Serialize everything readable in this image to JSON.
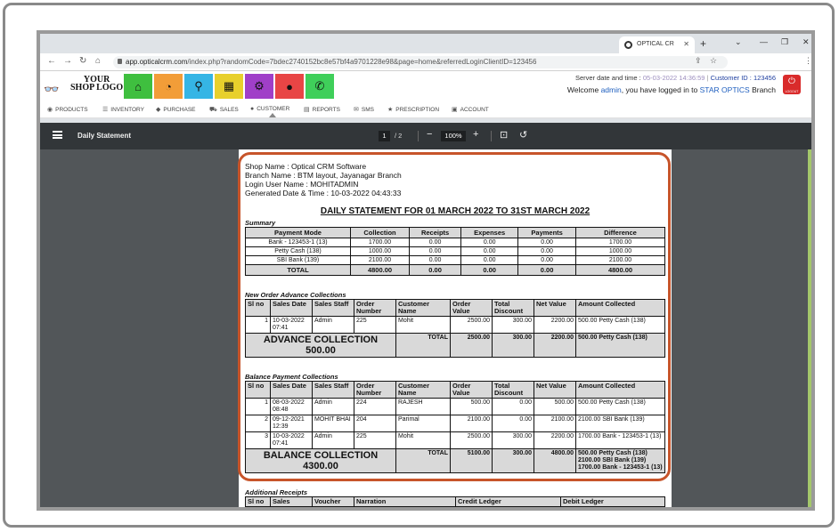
{
  "browser": {
    "tab_title": "OPTICAL CR",
    "url_host": "app.opticalcrm.com",
    "url_path": "/index.php?randomCode=7bdec2740152bc8e57bf4a9701228e98&page=home&referredLoginClientID=123456"
  },
  "header": {
    "logo_line1": "YOUR",
    "logo_line2": "SHOP LOGO",
    "server_label": "Server date and time :",
    "server_datetime": "05-03-2022 14:36:59",
    "customer_id": "Customer ID : 123456",
    "welcome_pre": "Welcome",
    "user": "admin",
    "welcome_mid": ", you have logged in to",
    "branch": "STAR OPTICS",
    "welcome_post": "Branch",
    "logout_label": "LOGOUT",
    "tiles": [
      {
        "icon": "home-icon",
        "color": "#3fbf3f"
      },
      {
        "icon": "dashboard-icon",
        "color": "#f29d38"
      },
      {
        "icon": "search-icon",
        "color": "#35b5e5"
      },
      {
        "icon": "grid-icon",
        "color": "#e8d02c"
      },
      {
        "icon": "gear-icon",
        "color": "#a03fc8"
      },
      {
        "icon": "user-icon",
        "color": "#e84545"
      },
      {
        "icon": "whatsapp-icon",
        "color": "#3fcf5a"
      }
    ]
  },
  "menu": [
    "PRODUCTS",
    "INVENTORY",
    "PURCHASE",
    "SALES",
    "CUSTOMER",
    "REPORTS",
    "SMS",
    "PRESCRIPTION",
    "ACCOUNT"
  ],
  "viewer": {
    "title": "Daily Statement",
    "page_current": "1",
    "page_total": "/ 2",
    "zoom": "100%"
  },
  "doc": {
    "shop": "Shop Name : Optical CRM Software",
    "branch": "Branch Name : BTM layout, Jayanagar Branch",
    "login_user": "Login User Name : MOHITADMIN",
    "generated": "Generated Date & Time  : 10-03-2022 04:43:33",
    "title": "DAILY STATEMENT FOR 01 MARCH 2022 TO 31ST MARCH 2022",
    "summary": {
      "heading": "Summary",
      "cols": [
        "Payment Mode",
        "Collection",
        "Receipts",
        "Expenses",
        "Payments",
        "Difference"
      ],
      "rows": [
        [
          "Bank - 123453-1 (13)",
          "1700.00",
          "0.00",
          "0.00",
          "0.00",
          "1700.00"
        ],
        [
          "Petty Cash (138)",
          "1000.00",
          "0.00",
          "0.00",
          "0.00",
          "1000.00"
        ],
        [
          "SBI Bank (139)",
          "2100.00",
          "0.00",
          "0.00",
          "0.00",
          "2100.00"
        ]
      ],
      "total": [
        "TOTAL",
        "4800.00",
        "0.00",
        "0.00",
        "0.00",
        "4800.00"
      ]
    },
    "advance": {
      "heading": "New Order Advance Collections",
      "cols": [
        "Sl no",
        "Sales Date",
        "Sales Staff",
        "Order Number",
        "Customer Name",
        "Order Value",
        "Total Discount",
        "Net Value",
        "Amount Collected"
      ],
      "rows": [
        [
          "1",
          "10-03-2022 07:41",
          "Admin",
          "225",
          "Mohit",
          "2500.00",
          "300.00",
          "2200.00",
          "500.00 Petty Cash (138)"
        ]
      ],
      "big_label": "ADVANCE COLLECTION",
      "big_value": "500.00",
      "total_label": "TOTAL",
      "total": [
        "2500.00",
        "300.00",
        "2200.00",
        "500.00 Petty Cash (138)"
      ]
    },
    "balance": {
      "heading": "Balance Payment Collections",
      "cols": [
        "Sl no",
        "Sales Date",
        "Sales Staff",
        "Order Number",
        "Customer Name",
        "Order Value",
        "Total Discount",
        "Net Value",
        "Amount Collected"
      ],
      "rows": [
        [
          "1",
          "08-03-2022 08:48",
          "Admin",
          "224",
          "RAJESH",
          "500.00",
          "0.00",
          "500.00",
          "500.00 Petty Cash (138)"
        ],
        [
          "2",
          "09-12-2021 12:39",
          "MOHIT BHAI",
          "204",
          "Parimal",
          "2100.00",
          "0.00",
          "2100.00",
          "2100.00 SBI Bank (139)"
        ],
        [
          "3",
          "10-03-2022 07:41",
          "Admin",
          "225",
          "Mohit",
          "2500.00",
          "300.00",
          "2200.00",
          "1700.00 Bank - 123453-1 (13)"
        ]
      ],
      "big_label": "BALANCE COLLECTION",
      "big_value": "4300.00",
      "total_label": "TOTAL",
      "total": [
        "5100.00",
        "300.00",
        "4800.00",
        "500.00 Petty Cash (138) 2100.00 SBI Bank (139) 1700.00 Bank - 123453-1 (13)"
      ]
    },
    "additional": {
      "heading": "Additional Receipts",
      "cols": [
        "Sl no",
        "Sales",
        "Voucher",
        "Narration",
        "Credit Ledger",
        "Debit Ledger"
      ]
    }
  }
}
